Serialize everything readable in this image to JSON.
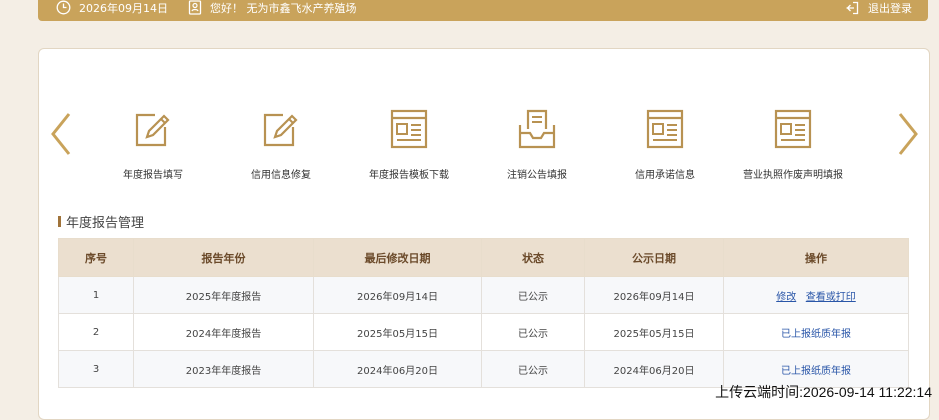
{
  "topbar": {
    "date": "2026年09月14日",
    "greeting": "您好！ 无为市鑫飞水产养殖场",
    "logout": "退出登录"
  },
  "menu": {
    "items": [
      {
        "label": "年度报告填写",
        "icon": "edit-form-icon"
      },
      {
        "label": "信用信息修复",
        "icon": "edit-form-icon"
      },
      {
        "label": "年度报告模板下载",
        "icon": "document-list-icon"
      },
      {
        "label": "注销公告填报",
        "icon": "inbox-document-icon"
      },
      {
        "label": "信用承诺信息",
        "icon": "document-list-icon"
      },
      {
        "label": "营业执照作废声明填报",
        "icon": "document-list-icon"
      }
    ]
  },
  "section": {
    "title": "年度报告管理"
  },
  "table": {
    "headers": [
      "序号",
      "报告年份",
      "最后修改日期",
      "状态",
      "公示日期",
      "操作"
    ],
    "rows": [
      {
        "no": "1",
        "year": "2025年年度报告",
        "modified": "2026年09月14日",
        "status": "已公示",
        "published": "2026年09月14日",
        "action1": "修改",
        "action2": "查看或打印"
      },
      {
        "no": "2",
        "year": "2024年年度报告",
        "modified": "2025年05月15日",
        "status": "已公示",
        "published": "2025年05月15日",
        "action1": "已上报纸质年报",
        "action2": ""
      },
      {
        "no": "3",
        "year": "2023年年度报告",
        "modified": "2024年06月20日",
        "status": "已公示",
        "published": "2024年06月20日",
        "action1": "已上报纸质年报",
        "action2": ""
      }
    ]
  },
  "upload_time": "上传云端时间:2026-09-14 11:22:14",
  "colors": {
    "accent": "#c9a35b",
    "icon": "#b89252",
    "link": "#2a56a8"
  }
}
